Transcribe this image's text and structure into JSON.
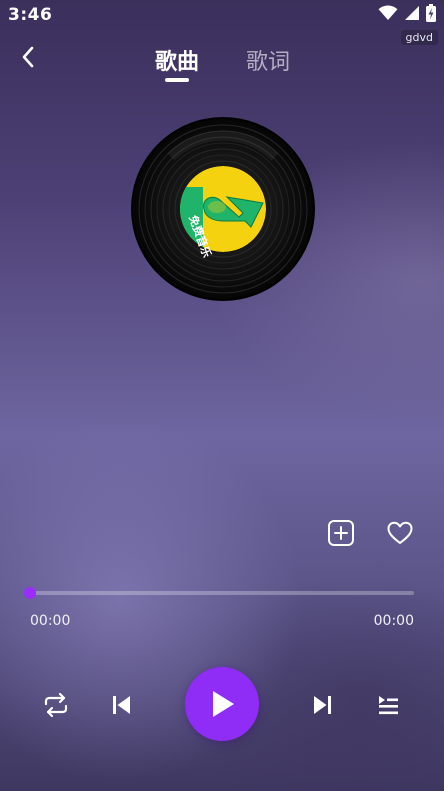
{
  "status_bar": {
    "time": "3:46",
    "wifi_icon": "wifi-icon",
    "signal_icon": "cellular-signal-icon",
    "battery_icon": "battery-charging-icon",
    "tag": "gdvd"
  },
  "header": {
    "back_icon": "chevron-left-icon",
    "tabs": [
      {
        "label": "歌曲",
        "active": true
      },
      {
        "label": "歌词",
        "active": false
      }
    ]
  },
  "record": {
    "label_text": "免费音乐",
    "label_colors": {
      "yellow": "#f5d20f",
      "green": "#1fb46a"
    },
    "logo_icon": "music-note-logo-icon"
  },
  "actions": {
    "add_icon": "add-square-icon",
    "favorite_icon": "heart-outline-icon"
  },
  "player": {
    "progress": 0,
    "current_time": "00:00",
    "total_time": "00:00",
    "accent_color": "#9a2cff"
  },
  "controls": {
    "repeat_icon": "repeat-icon",
    "prev_icon": "skip-previous-icon",
    "play_icon": "play-icon",
    "next_icon": "skip-next-icon",
    "playlist_icon": "playlist-icon"
  }
}
